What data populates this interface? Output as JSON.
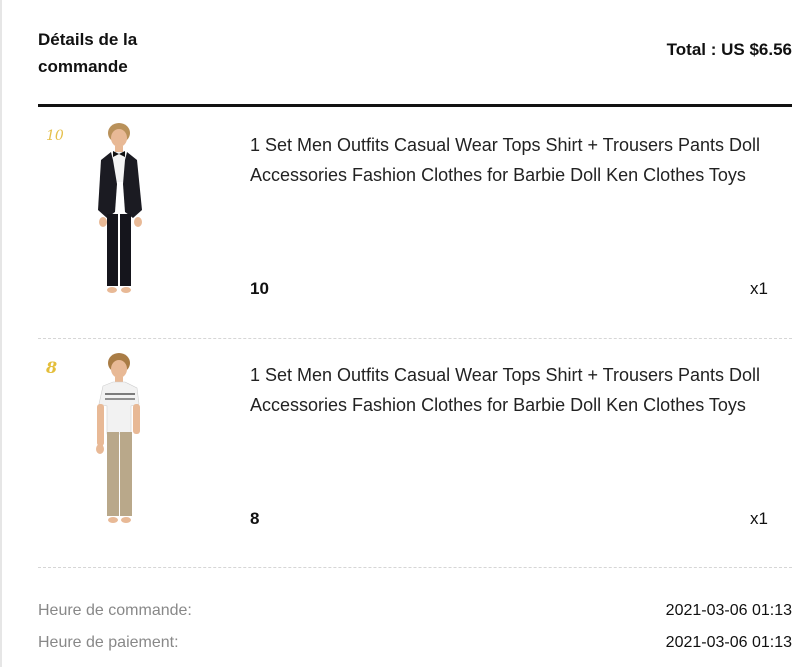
{
  "header": {
    "title": "Détails de la commande",
    "total": "Total : US $6.56"
  },
  "items": [
    {
      "thumb_label": "10",
      "image_icon": "doll-black-suit-icon",
      "title": "1 Set Men Outfits Casual Wear Tops Shirt + Trousers Pants Doll Accessories Fashion Clothes for Barbie Doll Ken Clothes Toys",
      "variant": "10",
      "quantity": "x1"
    },
    {
      "thumb_label": "8",
      "image_icon": "doll-white-shirt-khaki-pants-icon",
      "title": "1 Set Men Outfits Casual Wear Tops Shirt + Trousers Pants Doll Accessories Fashion Clothes for Barbie Doll Ken Clothes Toys",
      "variant": "8",
      "quantity": "x1"
    }
  ],
  "meta": {
    "order_time_label": "Heure de commande:",
    "order_time_value": "2021-03-06 01:13",
    "payment_time_label": "Heure de paiement:",
    "payment_time_value": "2021-03-06 01:13"
  },
  "colors": {
    "rule": "#111111",
    "label_gray": "#888888",
    "thumb_number": "#e5c04c"
  }
}
